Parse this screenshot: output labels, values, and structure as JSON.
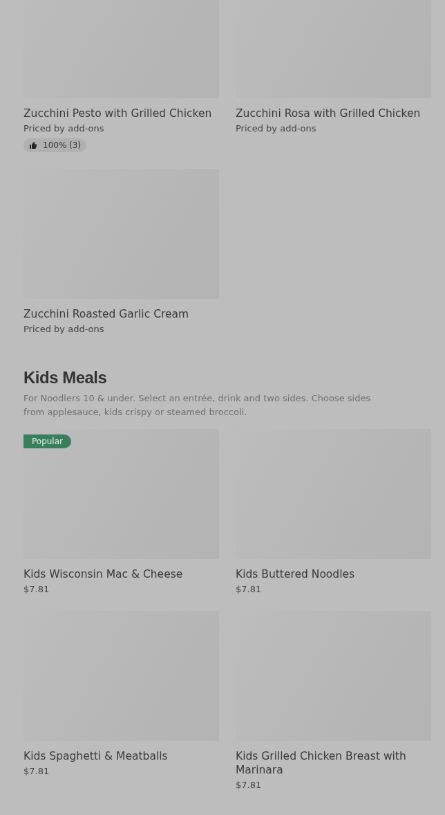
{
  "sections": [
    {
      "items": [
        {
          "name": "Zucchini Pesto with Grilled Chicken",
          "price": "Priced by add-ons",
          "rating": "100% (3)"
        },
        {
          "name": "Zucchini Rosa with Grilled Chicken",
          "price": "Priced by add-ons"
        },
        {
          "name": "Zucchini Roasted Garlic Cream",
          "price": "Priced by add-ons"
        }
      ]
    },
    {
      "title": "Kids Meals",
      "description": "For Noodlers 10 & under. Select an entrée, drink and two sides. Choose sides from applesauce, kids crispy or steamed broccoli.",
      "items": [
        {
          "name": "Kids Wisconsin Mac & Cheese",
          "price": "$7.81",
          "badge": "Popular"
        },
        {
          "name": "Kids Buttered Noodles",
          "price": "$7.81"
        },
        {
          "name": "Kids Spaghetti & Meatballs",
          "price": "$7.81"
        },
        {
          "name": "Kids Grilled Chicken Breast with Marinara",
          "price": "$7.81"
        }
      ]
    }
  ]
}
